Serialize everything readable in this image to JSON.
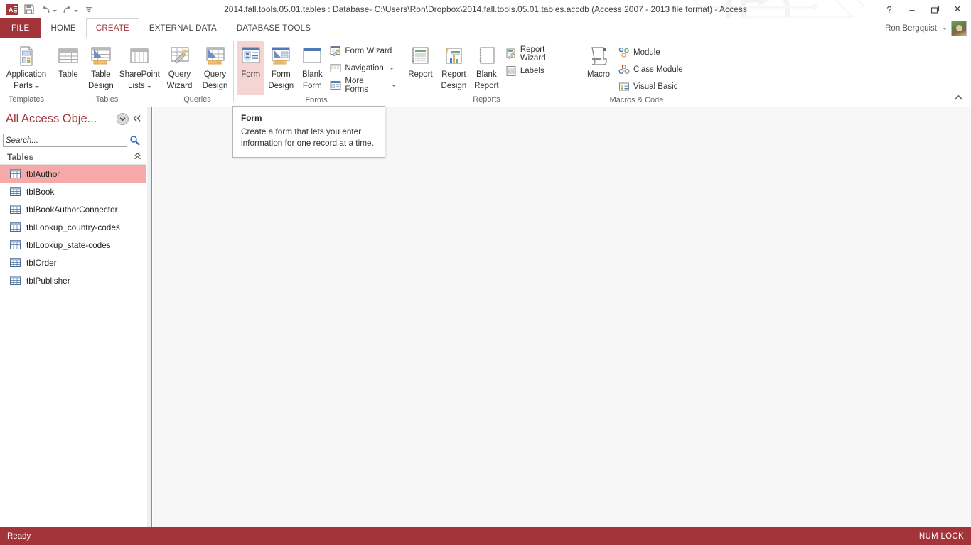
{
  "titlebar": {
    "title": "2014.fall.tools.05.01.tables : Database- C:\\Users\\Ron\\Dropbox\\2014.fall.tools.05.01.tables.accdb (Access 2007 - 2013 file format) - Access",
    "app_icon": "access-logo-icon",
    "quick_access": [
      {
        "name": "save-icon",
        "label": "Save"
      },
      {
        "name": "undo-icon",
        "label": "Undo"
      },
      {
        "name": "redo-icon",
        "label": "Redo"
      },
      {
        "name": "customize-quick-access-icon",
        "label": "Customize Quick Access Toolbar"
      }
    ],
    "window_controls": [
      {
        "name": "help-button",
        "glyph": "?"
      },
      {
        "name": "minimize-button",
        "glyph": "‒"
      },
      {
        "name": "restore-button",
        "glyph": "❐"
      },
      {
        "name": "close-button",
        "glyph": "✕"
      }
    ]
  },
  "account": {
    "user_name": "Ron Bergquist",
    "avatar": "user-avatar-photo"
  },
  "tabs": {
    "file_label": "FILE",
    "items": [
      {
        "label": "HOME",
        "active": false
      },
      {
        "label": "CREATE",
        "active": true
      },
      {
        "label": "EXTERNAL DATA",
        "active": false
      },
      {
        "label": "DATABASE TOOLS",
        "active": false
      }
    ]
  },
  "ribbon": {
    "collapse_icon": "chevron-up-icon",
    "groups": [
      {
        "label": "Templates",
        "big_buttons": [
          {
            "name": "application-parts-button",
            "line1": "Application",
            "line2": "Parts",
            "icon": "application-parts-icon",
            "dropdown": true,
            "highlight": false
          }
        ],
        "small_buttons": []
      },
      {
        "label": "Tables",
        "big_buttons": [
          {
            "name": "table-button",
            "line1": "Table",
            "line2": "",
            "icon": "table-icon",
            "dropdown": false,
            "highlight": false
          },
          {
            "name": "table-design-button",
            "line1": "Table",
            "line2": "Design",
            "icon": "table-design-icon",
            "dropdown": false,
            "highlight": false
          },
          {
            "name": "sharepoint-lists-button",
            "line1": "SharePoint",
            "line2": "Lists",
            "icon": "sharepoint-lists-icon",
            "dropdown": true,
            "highlight": false
          }
        ],
        "small_buttons": []
      },
      {
        "label": "Queries",
        "big_buttons": [
          {
            "name": "query-wizard-button",
            "line1": "Query",
            "line2": "Wizard",
            "icon": "query-wizard-icon",
            "dropdown": false,
            "highlight": false
          },
          {
            "name": "query-design-button",
            "line1": "Query",
            "line2": "Design",
            "icon": "query-design-icon",
            "dropdown": false,
            "highlight": false
          }
        ],
        "small_buttons": []
      },
      {
        "label": "Forms",
        "big_buttons": [
          {
            "name": "form-button",
            "line1": "Form",
            "line2": "",
            "icon": "form-icon",
            "dropdown": false,
            "highlight": true
          },
          {
            "name": "form-design-button",
            "line1": "Form",
            "line2": "Design",
            "icon": "form-design-icon",
            "dropdown": false,
            "highlight": false
          },
          {
            "name": "blank-form-button",
            "line1": "Blank",
            "line2": "Form",
            "icon": "blank-form-icon",
            "dropdown": false,
            "highlight": false
          }
        ],
        "small_buttons": [
          {
            "name": "form-wizard-button",
            "label": "Form Wizard",
            "icon": "form-wizard-icon",
            "dropdown": false
          },
          {
            "name": "navigation-button",
            "label": "Navigation",
            "icon": "navigation-icon",
            "dropdown": true
          },
          {
            "name": "more-forms-button",
            "label": "More Forms",
            "icon": "more-forms-icon",
            "dropdown": true
          }
        ]
      },
      {
        "label": "Reports",
        "big_buttons": [
          {
            "name": "report-button",
            "line1": "Report",
            "line2": "",
            "icon": "report-icon",
            "dropdown": false,
            "highlight": false
          },
          {
            "name": "report-design-button",
            "line1": "Report",
            "line2": "Design",
            "icon": "report-design-icon",
            "dropdown": false,
            "highlight": false
          },
          {
            "name": "blank-report-button",
            "line1": "Blank",
            "line2": "Report",
            "icon": "blank-report-icon",
            "dropdown": false,
            "highlight": false
          }
        ],
        "small_buttons": [
          {
            "name": "report-wizard-button",
            "label": "Report Wizard",
            "icon": "report-wizard-icon",
            "dropdown": false
          },
          {
            "name": "labels-button",
            "label": "Labels",
            "icon": "labels-icon",
            "dropdown": false
          }
        ]
      },
      {
        "label": "Macros & Code",
        "big_buttons": [
          {
            "name": "macro-button",
            "line1": "Macro",
            "line2": "",
            "icon": "macro-icon",
            "dropdown": false,
            "highlight": false
          }
        ],
        "small_buttons": [
          {
            "name": "module-button",
            "label": "Module",
            "icon": "module-icon",
            "dropdown": false
          },
          {
            "name": "class-module-button",
            "label": "Class Module",
            "icon": "class-module-icon",
            "dropdown": false
          },
          {
            "name": "visual-basic-button",
            "label": "Visual Basic",
            "icon": "visual-basic-icon",
            "dropdown": false
          }
        ]
      }
    ]
  },
  "navpane": {
    "title": "All Access Obje...",
    "dropdown_icon": "chevron-down-circle-icon",
    "collapse_icon": "double-chevron-left-icon",
    "search": {
      "value": "",
      "placeholder": "Search..."
    },
    "search_icon": "search-icon",
    "group": {
      "label": "Tables",
      "collapse_icon": "double-chevron-up-icon"
    },
    "items": [
      {
        "label": "tblAuthor",
        "selected": true
      },
      {
        "label": "tblBook",
        "selected": false
      },
      {
        "label": "tblBookAuthorConnector",
        "selected": false
      },
      {
        "label": "tblLookup_country-codes",
        "selected": false
      },
      {
        "label": "tblLookup_state-codes",
        "selected": false
      },
      {
        "label": "tblOrder",
        "selected": false
      },
      {
        "label": "tblPublisher",
        "selected": false
      }
    ]
  },
  "tooltip": {
    "title": "Form",
    "body": "Create a form that lets you enter information for one record at a time."
  },
  "statusbar": {
    "left": "Ready",
    "right": "NUM LOCK"
  },
  "colors": {
    "accent": "#A33439",
    "highlight_pink": "#F6D4D4",
    "selection_pink": "#F6A9A9",
    "workarea": "#F7F7F7"
  }
}
